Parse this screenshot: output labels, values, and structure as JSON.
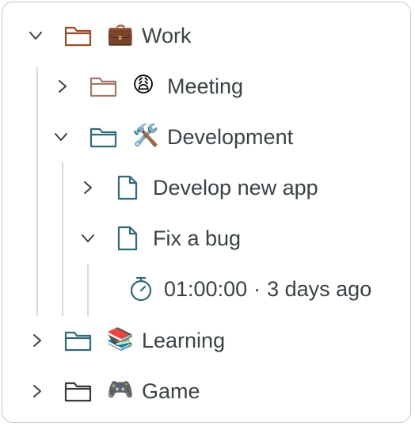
{
  "tree": {
    "work": {
      "label": "Work",
      "emoji": "💼",
      "folder_color": "#9a4a24",
      "expanded": true,
      "children": {
        "meeting": {
          "label": "Meeting",
          "emoji": "😩",
          "folder_color": "#a0776a",
          "expanded": false
        },
        "development": {
          "label": "Development",
          "emoji": "🛠️",
          "folder_color": "#2f6b75",
          "expanded": true,
          "children": {
            "develop_new_app": {
              "label": "Develop new app",
              "icon": "document-icon",
              "expanded": false
            },
            "fix_a_bug": {
              "label": "Fix a bug",
              "icon": "document-icon",
              "expanded": true,
              "timer": {
                "icon": "stopwatch-icon",
                "duration": "01:00:00",
                "separator": "·",
                "when": "3 days ago"
              }
            }
          }
        }
      }
    },
    "learning": {
      "label": "Learning",
      "emoji": "📚",
      "folder_color": "#2f6b75",
      "expanded": false
    },
    "game": {
      "label": "Game",
      "emoji": "🎮",
      "folder_color": "#3a3a3a",
      "expanded": false
    }
  },
  "colors": {
    "text": "#3a4346",
    "chevron": "#3a4346",
    "guide_line": "#d8d8d8",
    "accent_teal": "#2f6b75"
  }
}
